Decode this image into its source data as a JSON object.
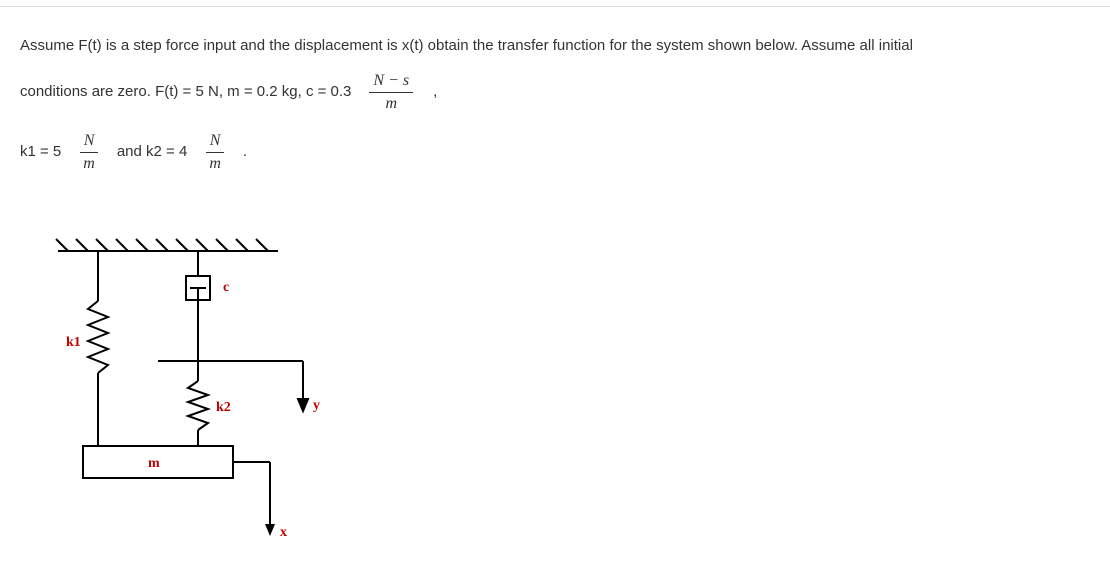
{
  "problem": {
    "line1": "Assume F(t) is a step force input and the displacement is x(t) obtain the transfer function for the system shown below. Assume all initial",
    "line2_prefix": "conditions are zero. F(t) = 5 N, m = 0.2 kg, c = 0.3",
    "c_unit_num": "N − s",
    "c_unit_den": "m",
    "k1_prefix": "k1 = 5",
    "k_unit_num": "N",
    "k_unit_den": "m",
    "k2_prefix": "and k2 = 4",
    "period": "."
  },
  "diagram_labels": {
    "k1": "k1",
    "k2": "k2",
    "c": "c",
    "m": "m",
    "y": "y",
    "x": "x"
  }
}
